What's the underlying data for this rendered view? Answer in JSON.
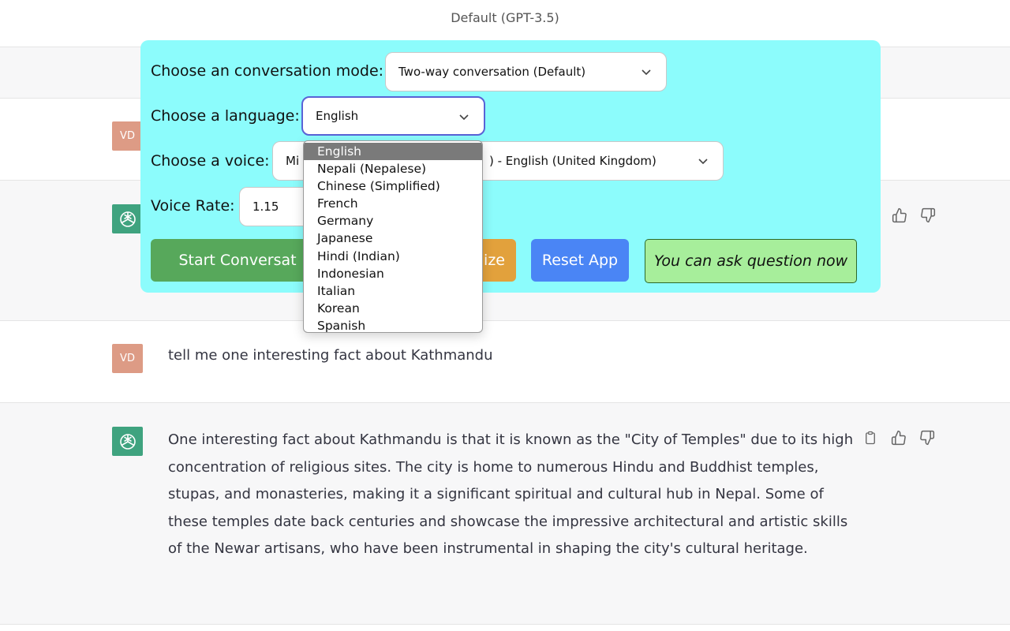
{
  "header": {
    "model_title": "Default (GPT-3.5)"
  },
  "user_avatar_initials": "VD",
  "controls": {
    "mode_label": "Choose an conversation mode:",
    "mode_value": "Two-way conversation (Default)",
    "language_label": "Choose a language:",
    "language_value": "English",
    "voice_label": "Choose a voice:",
    "voice_value_start": "Mi",
    "voice_value_end": ") - English (United Kingdom)",
    "rate_label": "Voice Rate:",
    "rate_value": "1.15",
    "start_button": "Start Conversat",
    "middle_button_partial": "ize",
    "reset_button": "Reset App",
    "status_text": "You can ask question now"
  },
  "language_options": [
    "English",
    "Nepali (Nepalese)",
    "Chinese (Simplified)",
    "French",
    "Germany",
    "Japanese",
    "Hindi (Indian)",
    "Indonesian",
    "Italian",
    "Korean",
    "Spanish"
  ],
  "messages": {
    "user_question": "tell me one interesting fact about Kathmandu",
    "bot_answer": "One interesting fact about Kathmandu is that it is known as the \"City of Temples\" due to its high concentration of religious sites. The city is home to numerous Hindu and Buddhist temples, stupas, and monasteries, making it a significant spiritual and cultural hub in Nepal. Some of these temples date back centuries and showcase the impressive architectural and artistic skills of the Newar artisans, who have been instrumental in shaping the city's cultural heritage."
  },
  "colors": {
    "panel_bg": "#8cfcfc",
    "start_button": "#57a85b",
    "orange_button": "#e2a13c",
    "reset_button": "#4a85f5",
    "status_bg": "#a7ee9b",
    "user_avatar": "#dd9b85",
    "bot_avatar": "#3fa37f"
  },
  "icons": [
    "chevron-down-icon",
    "openai-logo-icon",
    "copy-icon",
    "thumbs-up-icon",
    "thumbs-down-icon"
  ]
}
